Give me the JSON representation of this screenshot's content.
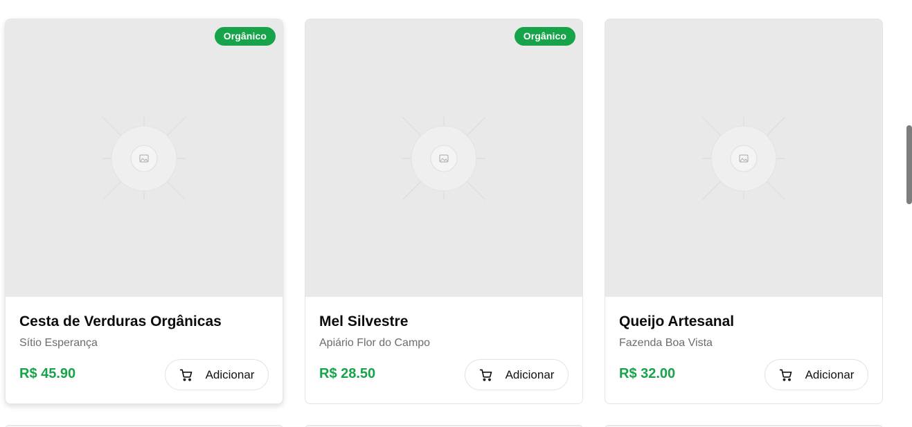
{
  "products": [
    {
      "name": "Cesta de Verduras Orgânicas",
      "producer": "Sítio Esperança",
      "price": "R$ 45.90",
      "badge": "Orgânico",
      "add_label": "Adicionar"
    },
    {
      "name": "Mel Silvestre",
      "producer": "Apiário Flor do Campo",
      "price": "R$ 28.50",
      "badge": "Orgânico",
      "add_label": "Adicionar"
    },
    {
      "name": "Queijo Artesanal",
      "producer": "Fazenda Boa Vista",
      "price": "R$ 32.00",
      "badge": "",
      "add_label": "Adicionar"
    }
  ],
  "icons": {
    "image_placeholder": "image-placeholder-icon",
    "cart": "shopping-cart-icon"
  },
  "colors": {
    "accent": "#16a34a",
    "placeholder_bg": "#e9e9e9"
  }
}
